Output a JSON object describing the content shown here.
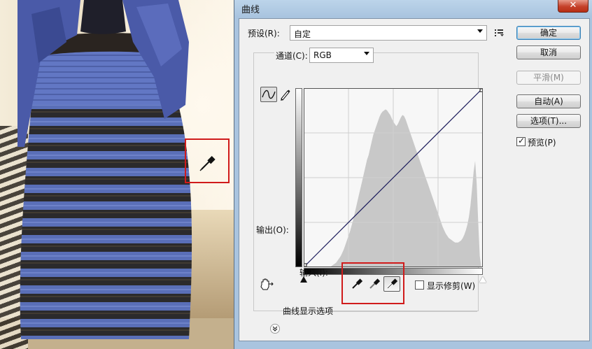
{
  "dialog": {
    "title": "曲线",
    "close_glyph": "✕",
    "preset_label": "预设(R):",
    "preset_value": "自定",
    "channel_label": "通道(C):",
    "channel_value": "RGB",
    "output_label": "输出(O):",
    "input_label": "输入(I):",
    "show_clipping_label": "显示修剪(W)",
    "curve_options_label": "曲线显示选项",
    "buttons": {
      "ok": "确定",
      "cancel": "取消",
      "smooth": "平滑(M)",
      "auto": "自动(A)",
      "options": "选项(T)..."
    },
    "preview_label": "预览(P)",
    "preview_checked": true,
    "show_clipping_checked": false,
    "icons": {
      "preset_menu": "preset-options-icon",
      "curve_tool": "curve-edit-icon",
      "pencil_tool": "pencil-icon",
      "on_image_adjust": "hand-adjust-icon",
      "black_eyedropper": "black-point-eyedropper-icon",
      "gray_eyedropper": "gray-point-eyedropper-icon",
      "white_eyedropper": "white-point-eyedropper-icon",
      "expand": "chevron-down-icon"
    },
    "colors": {
      "highlight_box": "#d01b1b",
      "curve_line": "#1a1a5a",
      "histogram": "#c8c8c8"
    },
    "selected_eyedropper": "white"
  },
  "histogram_levels": [
    0,
    0,
    0,
    0,
    0,
    0,
    0,
    0,
    0,
    0,
    0,
    0,
    0,
    0,
    0,
    0,
    0,
    0,
    1,
    2,
    3,
    4,
    6,
    8,
    10,
    13,
    16,
    20,
    24,
    28,
    32,
    37,
    42,
    48,
    54,
    60,
    66,
    72,
    78,
    84,
    90,
    96,
    100,
    106,
    112,
    118,
    122,
    126,
    130,
    134,
    137,
    139,
    140,
    141,
    140,
    138,
    136,
    133,
    130,
    128,
    126,
    128,
    131,
    134,
    136,
    135,
    132,
    128,
    124,
    120,
    116,
    112,
    108,
    104,
    100,
    96,
    92,
    88,
    84,
    80,
    76,
    72,
    68,
    64,
    60,
    56,
    52,
    48,
    44,
    40,
    36,
    33,
    30,
    28,
    26,
    25,
    24,
    23,
    22,
    22,
    22,
    23,
    24,
    26,
    29,
    33,
    38,
    45,
    55,
    70,
    85,
    95,
    75,
    40,
    10,
    0,
    0
  ]
}
